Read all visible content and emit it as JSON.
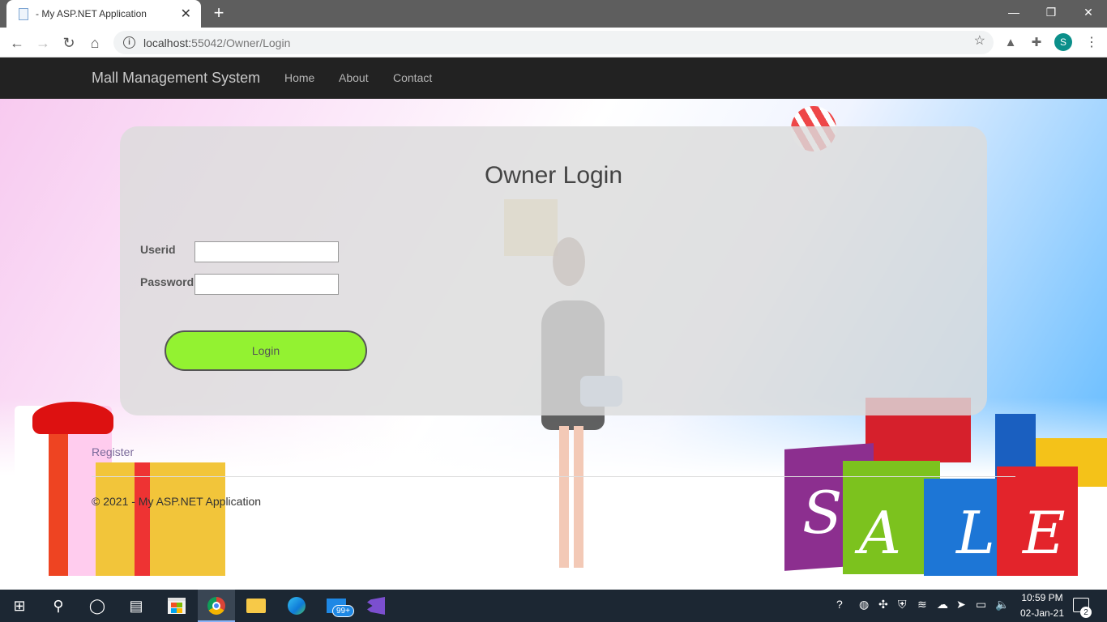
{
  "browser": {
    "tab_title": "- My ASP.NET Application",
    "url_host": "localhost:",
    "url_rest": "55042/Owner/Login",
    "avatar_letter": "S"
  },
  "navbar": {
    "brand": "Mall Management System",
    "links": [
      "Home",
      "About",
      "Contact"
    ]
  },
  "login": {
    "title": "Owner Login",
    "userid_label": "Userid",
    "password_label": "Password",
    "userid_value": "",
    "password_value": "",
    "button_label": "Login",
    "button_color": "#93f231"
  },
  "register_link": "Register",
  "footer": "© 2021 - My ASP.NET Application",
  "sale_letters": [
    "S",
    "A",
    "L",
    "E"
  ],
  "taskbar": {
    "mail_badge": "99+",
    "time": "10:59 PM",
    "date": "02-Jan-21",
    "notification_count": "2"
  }
}
